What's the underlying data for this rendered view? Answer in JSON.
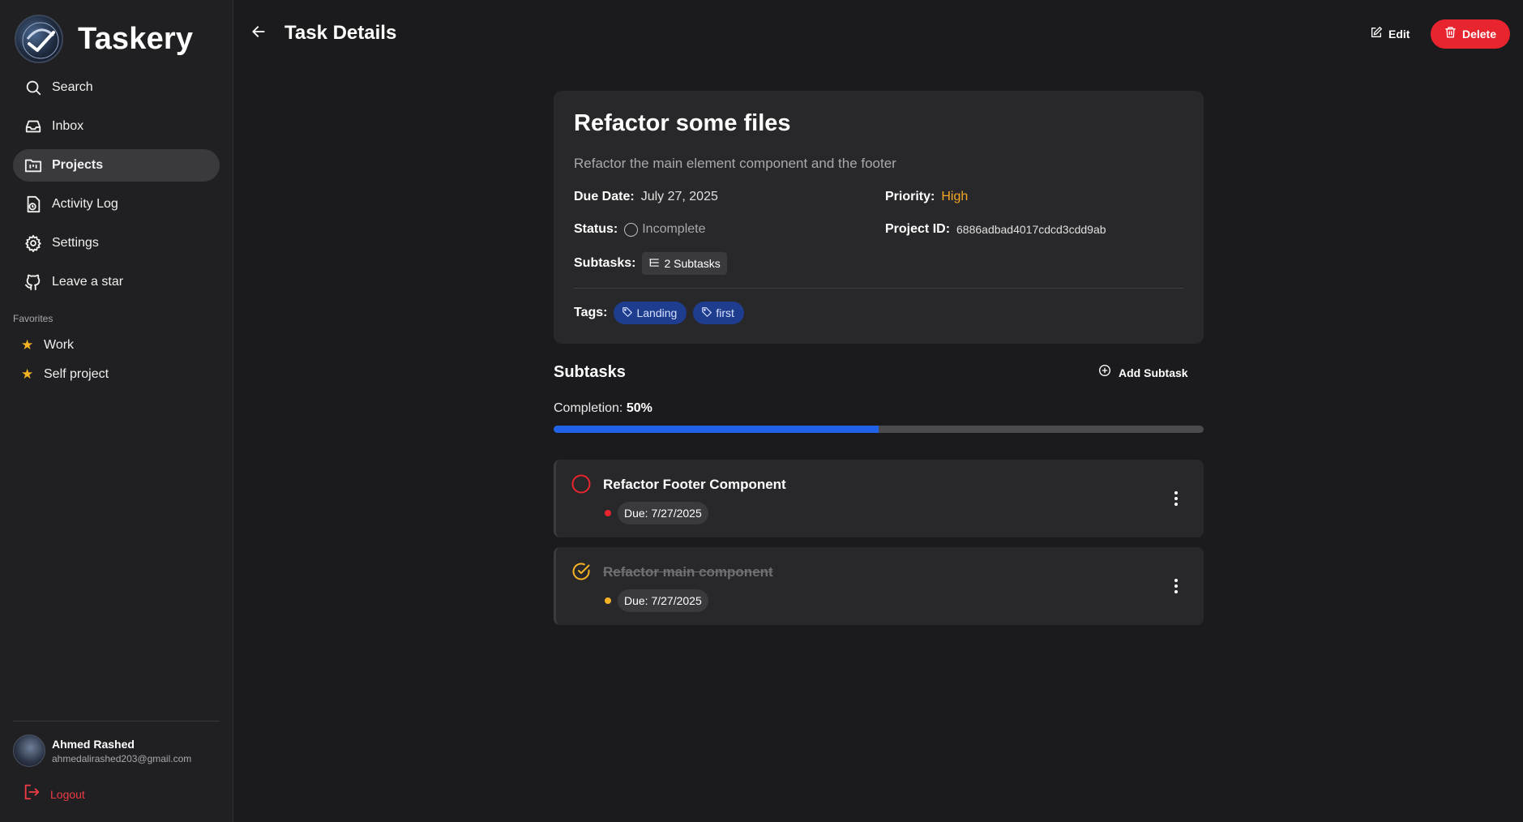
{
  "app": {
    "name": "Taskery"
  },
  "sidebar": {
    "items": [
      {
        "label": "Search",
        "icon": "search-icon"
      },
      {
        "label": "Inbox",
        "icon": "inbox-icon"
      },
      {
        "label": "Projects",
        "icon": "projects-icon",
        "active": true
      },
      {
        "label": "Activity Log",
        "icon": "activity-log-icon"
      },
      {
        "label": "Settings",
        "icon": "gear-icon"
      },
      {
        "label": "Leave a star",
        "icon": "github-icon"
      }
    ],
    "favorites_title": "Favorites",
    "favorites": [
      {
        "label": "Work"
      },
      {
        "label": "Self project"
      }
    ],
    "user": {
      "name": "Ahmed Rashed",
      "email": "ahmedalirashed203@gmail.com"
    },
    "logout_label": "Logout"
  },
  "header": {
    "title": "Task Details",
    "edit_label": "Edit",
    "delete_label": "Delete"
  },
  "task": {
    "title": "Refactor some files",
    "description": "Refactor the main element component and the footer",
    "due_label": "Due Date:",
    "due_value": "July 27, 2025",
    "priority_label": "Priority:",
    "priority_value": "High",
    "status_label": "Status:",
    "status_value": "Incomplete",
    "project_id_label": "Project ID:",
    "project_id_value": "6886adbad4017cdcd3cdd9ab",
    "subtasks_label": "Subtasks:",
    "subtasks_value": "2 Subtasks",
    "tags_label": "Tags:",
    "tags": [
      "Landing",
      "first"
    ]
  },
  "subtasks_section": {
    "title": "Subtasks",
    "add_label": "Add Subtask",
    "completion_label": "Completion:",
    "completion_value": "50%",
    "completion_fraction": 0.5,
    "items": [
      {
        "title": "Refactor Footer Component",
        "due": "Due: 7/27/2025",
        "completed": false,
        "priority_color": "#e8242f"
      },
      {
        "title": "Refactor main component",
        "due": "Due: 7/27/2025",
        "completed": true,
        "priority_color": "#f5b324"
      }
    ]
  },
  "colors": {
    "accent": "#2063e8",
    "danger": "#e8242f",
    "priority_high": "#f5a623",
    "tag_bg": "#1e3d8f"
  }
}
